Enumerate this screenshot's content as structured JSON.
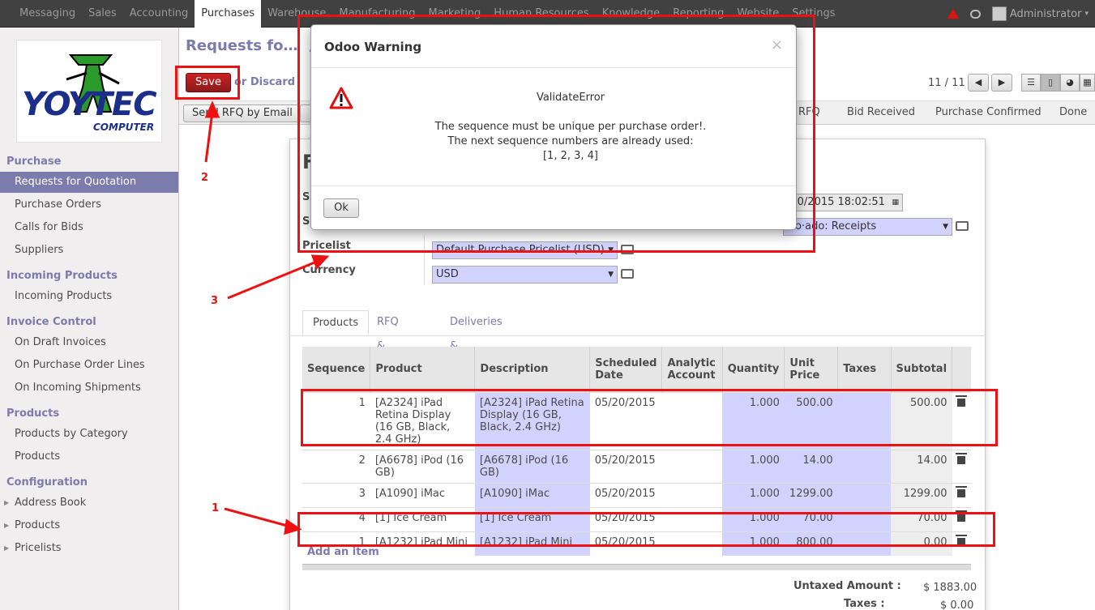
{
  "topbar": {
    "menu": [
      "Messaging",
      "Sales",
      "Accounting",
      "Purchases",
      "Warehouse",
      "Manufacturing",
      "Marketing",
      "Human Resources",
      "Knowledge",
      "Reporting",
      "Website",
      "Settings"
    ],
    "active": "Purchases",
    "user": "Administrator"
  },
  "sidebar": {
    "logo_text": "YOYTEC",
    "logo_sub": "COMPUTER",
    "sections": [
      {
        "title": "Purchase",
        "items": [
          "Requests for Quotation",
          "Purchase Orders",
          "Calls for Bids",
          "Suppliers"
        ]
      },
      {
        "title": "Incoming Products",
        "items": [
          "Incoming Products"
        ]
      },
      {
        "title": "Invoice Control",
        "items": [
          "On Draft Invoices",
          "On Purchase Order Lines",
          "On Incoming Shipments"
        ]
      },
      {
        "title": "Products",
        "items": [
          "Products by Category",
          "Products"
        ]
      },
      {
        "title": "Configuration",
        "items": [
          "Address Book",
          "Products",
          "Pricelists"
        ]
      }
    ]
  },
  "header": {
    "breadcrumb": "Requests fo…",
    "breadcrumb_sep": "/ P",
    "save_label": "Save",
    "discard_label": "or Discard",
    "pager": "11 / 11"
  },
  "statusbar": {
    "send_button": "Send RFQ by Email",
    "stages": [
      "RFQ",
      "Bid Received",
      "Purchase Confirmed",
      "Done"
    ]
  },
  "form": {
    "title_initial": "F",
    "label_s1": "S",
    "label_s2": "S",
    "pricelist_label": "Pricelist",
    "pricelist_value": "Default Purchase Pricelist (USD)",
    "currency_label": "Currency",
    "currency_value": "USD",
    "date_value": "/20/2015 18:02:51",
    "picking_value": "Do·ado: Receipts"
  },
  "tabs": [
    "Products",
    "RFQ & Bid",
    "Deliveries & Invoices"
  ],
  "table": {
    "headers": [
      "Sequence",
      "Product",
      "Description",
      "Scheduled Date",
      "Analytic Account",
      "Quantity",
      "Unit Price",
      "Taxes",
      "Subtotal"
    ],
    "rows": [
      {
        "seq": "1",
        "product": "[A2324] iPad Retina Display (16 GB, Black, 2.4 GHz)",
        "description": "[A2324] iPad Retina Display (16 GB, Black, 2.4 GHz)",
        "date": "05/20/2015",
        "analytic": "",
        "qty": "1.000",
        "price": "500.00",
        "taxes": "",
        "subtotal": "500.00"
      },
      {
        "seq": "2",
        "product": "[A6678] iPod (16 GB)",
        "description": "[A6678] iPod (16 GB)",
        "date": "05/20/2015",
        "analytic": "",
        "qty": "1.000",
        "price": "14.00",
        "taxes": "",
        "subtotal": "14.00"
      },
      {
        "seq": "3",
        "product": "[A1090] iMac",
        "description": "[A1090] iMac",
        "date": "05/20/2015",
        "analytic": "",
        "qty": "1.000",
        "price": "1299.00",
        "taxes": "",
        "subtotal": "1299.00"
      },
      {
        "seq": "4",
        "product": "[1] Ice Cream",
        "description": "[1] Ice Cream",
        "date": "05/20/2015",
        "analytic": "",
        "qty": "1.000",
        "price": "70.00",
        "taxes": "",
        "subtotal": "70.00"
      },
      {
        "seq": "1",
        "product": "[A1232] iPad Mini",
        "description": "[A1232] iPad Mini",
        "date": "05/20/2015",
        "analytic": "",
        "qty": "1.000",
        "price": "800.00",
        "taxes": "",
        "subtotal": "0.00"
      }
    ],
    "add_item": "Add an item"
  },
  "totals": {
    "untaxed_label": "Untaxed Amount :",
    "untaxed_value": "$ 1883.00",
    "taxes_label": "Taxes :",
    "taxes_value": "$ 0.00"
  },
  "modal": {
    "title": "Odoo Warning",
    "close": "×",
    "error_type": "ValidateError",
    "line1": "The sequence must be unique per purchase order!.",
    "line2": "The next sequence numbers are already used:",
    "line3": "[1, 2, 3, 4]",
    "ok_label": "Ok"
  },
  "annotations": {
    "n1": "1",
    "n2": "2",
    "n3": "3",
    "color": "#ee1111"
  }
}
